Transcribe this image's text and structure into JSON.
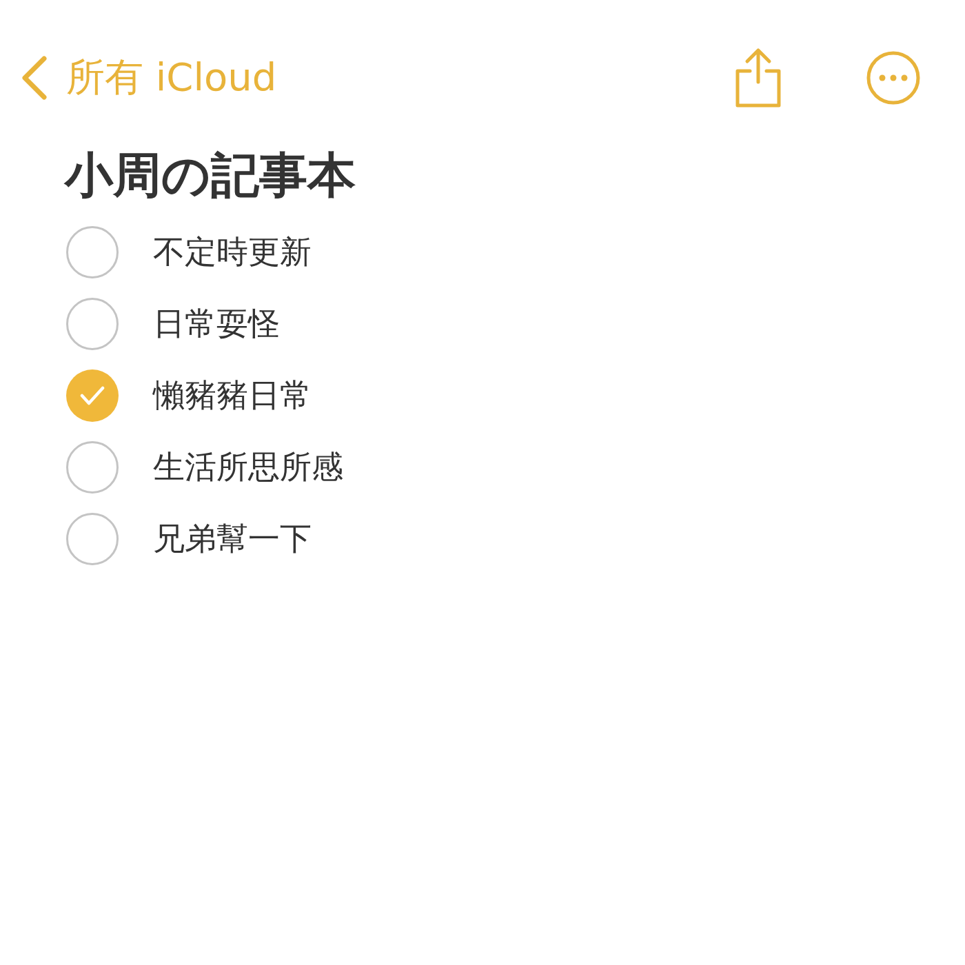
{
  "nav": {
    "back_label": "所有 iCloud"
  },
  "note": {
    "title": "小周の記事本",
    "checklist": [
      {
        "text": "不定時更新",
        "checked": false
      },
      {
        "text": "日常耍怪",
        "checked": false
      },
      {
        "text": "懶豬豬日常",
        "checked": true
      },
      {
        "text": "生活所思所感",
        "checked": false
      },
      {
        "text": "兄弟幫一下",
        "checked": false
      }
    ]
  }
}
